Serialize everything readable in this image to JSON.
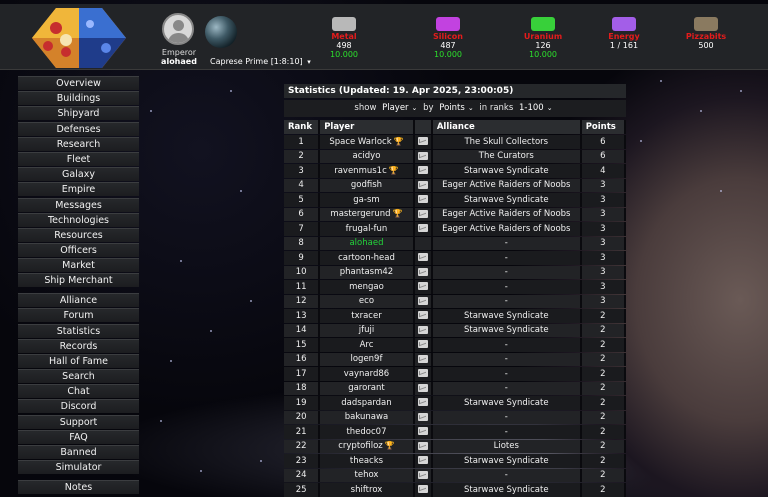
{
  "player": {
    "rank_label": "Emperor",
    "name": "alohaed"
  },
  "planet": {
    "name": "Caprese Prime [1:8:10]"
  },
  "resources": [
    {
      "name": "Metal",
      "value": "498",
      "production": "10.000",
      "color": "#b8b8b8",
      "icon": "metal-icon"
    },
    {
      "name": "Silicon",
      "value": "487",
      "production": "10.000",
      "color": "#c242e0",
      "icon": "silicon-icon"
    },
    {
      "name": "Uranium",
      "value": "126",
      "production": "10.000",
      "color": "#38d03a",
      "icon": "uranium-icon"
    },
    {
      "name": "Energy",
      "value": "1 / 161",
      "production": "",
      "color": "#a35ee8",
      "icon": "energy-icon"
    },
    {
      "name": "Pizzabits",
      "value": "500",
      "production": "",
      "color": "#8a7a60",
      "icon": "pizzabits-icon"
    }
  ],
  "nav": {
    "main": [
      "Overview",
      "Buildings",
      "Shipyard",
      "Defenses",
      "Research",
      "Fleet",
      "Galaxy",
      "Empire",
      "Messages",
      "Technologies",
      "Resources",
      "Officers",
      "Market",
      "Ship Merchant"
    ],
    "secondary": [
      "Alliance",
      "Forum",
      "Statistics",
      "Records",
      "Hall of Fame",
      "Search",
      "Chat",
      "Discord",
      "Support",
      "FAQ",
      "Banned",
      "Simulator"
    ],
    "tertiary": [
      "Notes"
    ]
  },
  "stats": {
    "title": "Statistics (Updated: 19. Apr 2025, 23:00:05)",
    "filter": {
      "show_label": "show",
      "show_value": "Player",
      "by_label": "by",
      "by_value": "Points",
      "ranks_label": "in ranks",
      "ranks_value": "1-100"
    },
    "columns": {
      "rank": "Rank",
      "player": "Player",
      "alliance": "Alliance",
      "points": "Points"
    },
    "rows": [
      {
        "rank": "1",
        "player": "Space Warlock",
        "trophy": true,
        "msg": true,
        "alliance": "The Skull Collectors",
        "points": "6"
      },
      {
        "rank": "2",
        "player": "acidyo",
        "trophy": false,
        "msg": true,
        "alliance": "The Curators",
        "points": "6"
      },
      {
        "rank": "3",
        "player": "ravenmus1c",
        "trophy": true,
        "msg": true,
        "alliance": "Starwave Syndicate",
        "points": "4"
      },
      {
        "rank": "4",
        "player": "godfish",
        "trophy": false,
        "msg": true,
        "alliance": "Eager Active Raiders of Noobs",
        "points": "3"
      },
      {
        "rank": "5",
        "player": "ga-sm",
        "trophy": false,
        "msg": true,
        "alliance": "Starwave Syndicate",
        "points": "3"
      },
      {
        "rank": "6",
        "player": "mastergerund",
        "trophy": true,
        "msg": true,
        "alliance": "Eager Active Raiders of Noobs",
        "points": "3"
      },
      {
        "rank": "7",
        "player": "frugal-fun",
        "trophy": false,
        "msg": true,
        "alliance": "Eager Active Raiders of Noobs",
        "points": "3"
      },
      {
        "rank": "8",
        "player": "alohaed",
        "trophy": false,
        "msg": false,
        "alliance": "-",
        "points": "3",
        "self": true
      },
      {
        "rank": "9",
        "player": "cartoon-head",
        "trophy": false,
        "msg": true,
        "alliance": "-",
        "points": "3"
      },
      {
        "rank": "10",
        "player": "phantasm42",
        "trophy": false,
        "msg": true,
        "alliance": "-",
        "points": "3"
      },
      {
        "rank": "11",
        "player": "mengao",
        "trophy": false,
        "msg": true,
        "alliance": "-",
        "points": "3"
      },
      {
        "rank": "12",
        "player": "eco",
        "trophy": false,
        "msg": true,
        "alliance": "-",
        "points": "3"
      },
      {
        "rank": "13",
        "player": "txracer",
        "trophy": false,
        "msg": true,
        "alliance": "Starwave Syndicate",
        "points": "2"
      },
      {
        "rank": "14",
        "player": "jfuji",
        "trophy": false,
        "msg": true,
        "alliance": "Starwave Syndicate",
        "points": "2"
      },
      {
        "rank": "15",
        "player": "Arc",
        "trophy": false,
        "msg": true,
        "alliance": "-",
        "points": "2"
      },
      {
        "rank": "16",
        "player": "logen9f",
        "trophy": false,
        "msg": true,
        "alliance": "-",
        "points": "2"
      },
      {
        "rank": "17",
        "player": "vaynard86",
        "trophy": false,
        "msg": true,
        "alliance": "-",
        "points": "2"
      },
      {
        "rank": "18",
        "player": "garorant",
        "trophy": false,
        "msg": true,
        "alliance": "-",
        "points": "2"
      },
      {
        "rank": "19",
        "player": "dadspardan",
        "trophy": false,
        "msg": true,
        "alliance": "Starwave Syndicate",
        "points": "2"
      },
      {
        "rank": "20",
        "player": "bakunawa",
        "trophy": false,
        "msg": true,
        "alliance": "-",
        "points": "2"
      },
      {
        "rank": "21",
        "player": "thedoc07",
        "trophy": false,
        "msg": true,
        "alliance": "-",
        "points": "2"
      },
      {
        "rank": "22",
        "player": "cryptofiloz",
        "trophy": true,
        "msg": true,
        "alliance": "Liotes",
        "points": "2"
      },
      {
        "rank": "23",
        "player": "theacks",
        "trophy": false,
        "msg": true,
        "alliance": "Starwave Syndicate",
        "points": "2"
      },
      {
        "rank": "24",
        "player": "tehox",
        "trophy": false,
        "msg": true,
        "alliance": "-",
        "points": "2"
      },
      {
        "rank": "25",
        "player": "shiftrox",
        "trophy": false,
        "msg": true,
        "alliance": "Starwave Syndicate",
        "points": "2"
      }
    ]
  }
}
